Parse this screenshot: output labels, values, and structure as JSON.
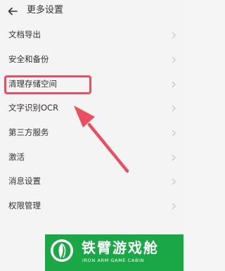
{
  "header": {
    "title": "更多设置",
    "back_icon": "arrow-left-icon"
  },
  "menu": {
    "items": [
      {
        "label": "文档导出"
      },
      {
        "label": "安全和备份"
      },
      {
        "label": "清理存储空间"
      },
      {
        "label": "文字识别OCR"
      },
      {
        "label": "第三方服务"
      },
      {
        "label": "激活"
      },
      {
        "label": "消息设置"
      },
      {
        "label": "权限管理"
      }
    ],
    "chevron_icon": "chevron-right-icon"
  },
  "annotation": {
    "color": "#ec4d5f"
  },
  "watermark": {
    "name_cn": "铁臂游戏舱",
    "name_en": "IRON ARM GAME CABIN",
    "color": "#1aa847"
  }
}
